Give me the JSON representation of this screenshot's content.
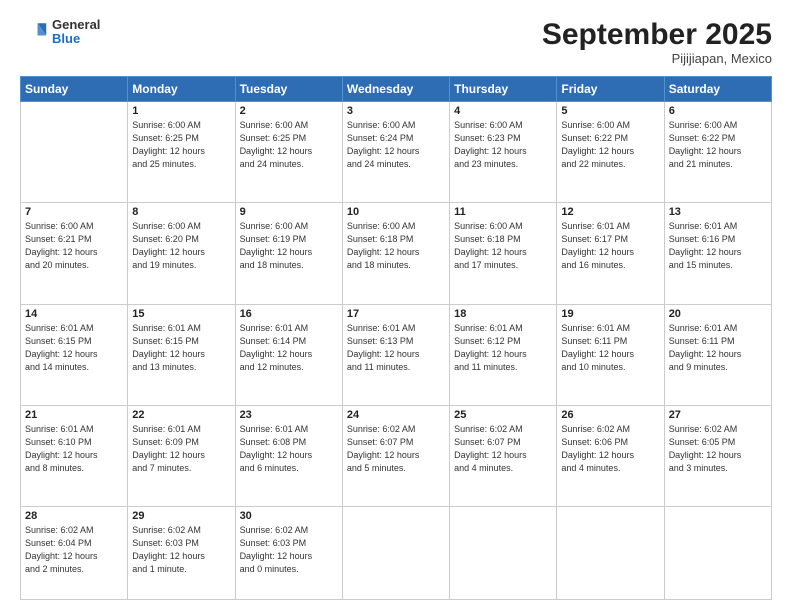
{
  "header": {
    "logo_general": "General",
    "logo_blue": "Blue",
    "month": "September 2025",
    "location": "Pijijiapan, Mexico"
  },
  "weekdays": [
    "Sunday",
    "Monday",
    "Tuesday",
    "Wednesday",
    "Thursday",
    "Friday",
    "Saturday"
  ],
  "weeks": [
    [
      {
        "day": "",
        "lines": []
      },
      {
        "day": "1",
        "lines": [
          "Sunrise: 6:00 AM",
          "Sunset: 6:25 PM",
          "Daylight: 12 hours",
          "and 25 minutes."
        ]
      },
      {
        "day": "2",
        "lines": [
          "Sunrise: 6:00 AM",
          "Sunset: 6:25 PM",
          "Daylight: 12 hours",
          "and 24 minutes."
        ]
      },
      {
        "day": "3",
        "lines": [
          "Sunrise: 6:00 AM",
          "Sunset: 6:24 PM",
          "Daylight: 12 hours",
          "and 24 minutes."
        ]
      },
      {
        "day": "4",
        "lines": [
          "Sunrise: 6:00 AM",
          "Sunset: 6:23 PM",
          "Daylight: 12 hours",
          "and 23 minutes."
        ]
      },
      {
        "day": "5",
        "lines": [
          "Sunrise: 6:00 AM",
          "Sunset: 6:22 PM",
          "Daylight: 12 hours",
          "and 22 minutes."
        ]
      },
      {
        "day": "6",
        "lines": [
          "Sunrise: 6:00 AM",
          "Sunset: 6:22 PM",
          "Daylight: 12 hours",
          "and 21 minutes."
        ]
      }
    ],
    [
      {
        "day": "7",
        "lines": [
          "Sunrise: 6:00 AM",
          "Sunset: 6:21 PM",
          "Daylight: 12 hours",
          "and 20 minutes."
        ]
      },
      {
        "day": "8",
        "lines": [
          "Sunrise: 6:00 AM",
          "Sunset: 6:20 PM",
          "Daylight: 12 hours",
          "and 19 minutes."
        ]
      },
      {
        "day": "9",
        "lines": [
          "Sunrise: 6:00 AM",
          "Sunset: 6:19 PM",
          "Daylight: 12 hours",
          "and 18 minutes."
        ]
      },
      {
        "day": "10",
        "lines": [
          "Sunrise: 6:00 AM",
          "Sunset: 6:18 PM",
          "Daylight: 12 hours",
          "and 18 minutes."
        ]
      },
      {
        "day": "11",
        "lines": [
          "Sunrise: 6:00 AM",
          "Sunset: 6:18 PM",
          "Daylight: 12 hours",
          "and 17 minutes."
        ]
      },
      {
        "day": "12",
        "lines": [
          "Sunrise: 6:01 AM",
          "Sunset: 6:17 PM",
          "Daylight: 12 hours",
          "and 16 minutes."
        ]
      },
      {
        "day": "13",
        "lines": [
          "Sunrise: 6:01 AM",
          "Sunset: 6:16 PM",
          "Daylight: 12 hours",
          "and 15 minutes."
        ]
      }
    ],
    [
      {
        "day": "14",
        "lines": [
          "Sunrise: 6:01 AM",
          "Sunset: 6:15 PM",
          "Daylight: 12 hours",
          "and 14 minutes."
        ]
      },
      {
        "day": "15",
        "lines": [
          "Sunrise: 6:01 AM",
          "Sunset: 6:15 PM",
          "Daylight: 12 hours",
          "and 13 minutes."
        ]
      },
      {
        "day": "16",
        "lines": [
          "Sunrise: 6:01 AM",
          "Sunset: 6:14 PM",
          "Daylight: 12 hours",
          "and 12 minutes."
        ]
      },
      {
        "day": "17",
        "lines": [
          "Sunrise: 6:01 AM",
          "Sunset: 6:13 PM",
          "Daylight: 12 hours",
          "and 11 minutes."
        ]
      },
      {
        "day": "18",
        "lines": [
          "Sunrise: 6:01 AM",
          "Sunset: 6:12 PM",
          "Daylight: 12 hours",
          "and 11 minutes."
        ]
      },
      {
        "day": "19",
        "lines": [
          "Sunrise: 6:01 AM",
          "Sunset: 6:11 PM",
          "Daylight: 12 hours",
          "and 10 minutes."
        ]
      },
      {
        "day": "20",
        "lines": [
          "Sunrise: 6:01 AM",
          "Sunset: 6:11 PM",
          "Daylight: 12 hours",
          "and 9 minutes."
        ]
      }
    ],
    [
      {
        "day": "21",
        "lines": [
          "Sunrise: 6:01 AM",
          "Sunset: 6:10 PM",
          "Daylight: 12 hours",
          "and 8 minutes."
        ]
      },
      {
        "day": "22",
        "lines": [
          "Sunrise: 6:01 AM",
          "Sunset: 6:09 PM",
          "Daylight: 12 hours",
          "and 7 minutes."
        ]
      },
      {
        "day": "23",
        "lines": [
          "Sunrise: 6:01 AM",
          "Sunset: 6:08 PM",
          "Daylight: 12 hours",
          "and 6 minutes."
        ]
      },
      {
        "day": "24",
        "lines": [
          "Sunrise: 6:02 AM",
          "Sunset: 6:07 PM",
          "Daylight: 12 hours",
          "and 5 minutes."
        ]
      },
      {
        "day": "25",
        "lines": [
          "Sunrise: 6:02 AM",
          "Sunset: 6:07 PM",
          "Daylight: 12 hours",
          "and 4 minutes."
        ]
      },
      {
        "day": "26",
        "lines": [
          "Sunrise: 6:02 AM",
          "Sunset: 6:06 PM",
          "Daylight: 12 hours",
          "and 4 minutes."
        ]
      },
      {
        "day": "27",
        "lines": [
          "Sunrise: 6:02 AM",
          "Sunset: 6:05 PM",
          "Daylight: 12 hours",
          "and 3 minutes."
        ]
      }
    ],
    [
      {
        "day": "28",
        "lines": [
          "Sunrise: 6:02 AM",
          "Sunset: 6:04 PM",
          "Daylight: 12 hours",
          "and 2 minutes."
        ]
      },
      {
        "day": "29",
        "lines": [
          "Sunrise: 6:02 AM",
          "Sunset: 6:03 PM",
          "Daylight: 12 hours",
          "and 1 minute."
        ]
      },
      {
        "day": "30",
        "lines": [
          "Sunrise: 6:02 AM",
          "Sunset: 6:03 PM",
          "Daylight: 12 hours",
          "and 0 minutes."
        ]
      },
      {
        "day": "",
        "lines": []
      },
      {
        "day": "",
        "lines": []
      },
      {
        "day": "",
        "lines": []
      },
      {
        "day": "",
        "lines": []
      }
    ]
  ]
}
